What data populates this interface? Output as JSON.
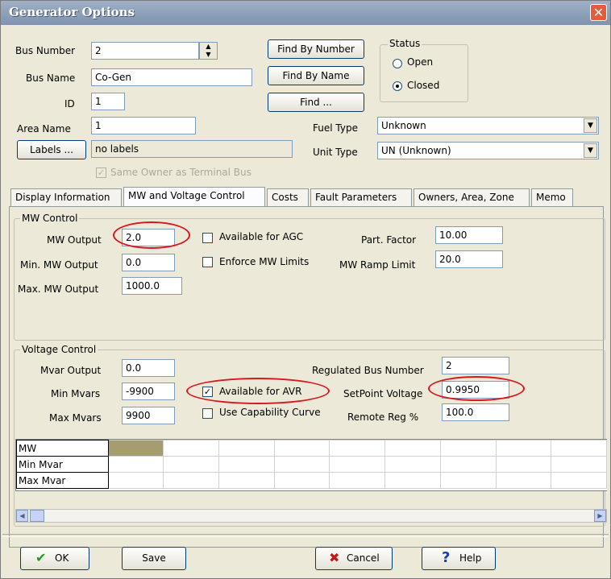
{
  "window": {
    "title": "Generator Options",
    "close_glyph": "✕"
  },
  "bus": {
    "number_label": "Bus Number",
    "number_value": "2",
    "name_label": "Bus Name",
    "name_value": "Co-Gen",
    "id_label": "ID",
    "id_value": "1",
    "area_label": "Area Name",
    "area_value": "1",
    "labels_button": "Labels ...",
    "labels_value": "no labels",
    "same_owner_label": "Same Owner as Terminal Bus"
  },
  "find": {
    "by_number": "Find By Number",
    "by_name": "Find By Name",
    "find": "Find ..."
  },
  "status": {
    "label": "Status",
    "open": "Open",
    "closed": "Closed",
    "selected": "Closed"
  },
  "fuel": {
    "label": "Fuel Type",
    "value": "Unknown"
  },
  "unit": {
    "label": "Unit Type",
    "value": "UN (Unknown)"
  },
  "tabs": [
    {
      "label": "Display Information"
    },
    {
      "label": "MW and Voltage Control",
      "active": true
    },
    {
      "label": "Costs"
    },
    {
      "label": "Fault Parameters"
    },
    {
      "label": "Owners, Area, Zone"
    },
    {
      "label": "Memo"
    }
  ],
  "mw_control": {
    "group_label": "MW Control",
    "mw_output_label": "MW Output",
    "mw_output_value": "2.0",
    "min_mw_label": "Min. MW Output",
    "min_mw_value": "0.0",
    "max_mw_label": "Max. MW Output",
    "max_mw_value": "1000.0",
    "agc_label": "Available for AGC",
    "agc_checked": false,
    "enforce_label": "Enforce MW Limits",
    "enforce_checked": false,
    "part_factor_label": "Part. Factor",
    "part_factor_value": "10.00",
    "ramp_label": "MW Ramp Limit",
    "ramp_value": "20.0"
  },
  "voltage_control": {
    "group_label": "Voltage Control",
    "mvar_output_label": "Mvar Output",
    "mvar_output_value": "0.0",
    "min_mvars_label": "Min Mvars",
    "min_mvars_value": "-9900",
    "max_mvars_label": "Max Mvars",
    "max_mvars_value": "9900",
    "avr_label": "Available for AVR",
    "avr_checked": true,
    "capability_label": "Use Capability Curve",
    "capability_checked": false,
    "reg_bus_label": "Regulated Bus Number",
    "reg_bus_value": "2",
    "setpoint_label": "SetPoint Voltage",
    "setpoint_value": "0.9950",
    "remote_reg_label": "Remote Reg %",
    "remote_reg_value": "100.0"
  },
  "curve_grid": {
    "rows": [
      "MW",
      "Min Mvar",
      "Max Mvar"
    ],
    "columns": 9
  },
  "buttons": {
    "ok": "OK",
    "save": "Save",
    "cancel": "Cancel",
    "help": "Help"
  },
  "colors": {
    "highlight_ring": "#d6181f",
    "ok_icon": "#1e9a1e",
    "cancel_icon": "#c01818",
    "help_icon": "#1c3fa8",
    "title_bar": "#8c9db5"
  },
  "icons": {
    "ok": "check-icon",
    "cancel": "x-icon",
    "help": "question-icon",
    "close": "close-icon"
  }
}
